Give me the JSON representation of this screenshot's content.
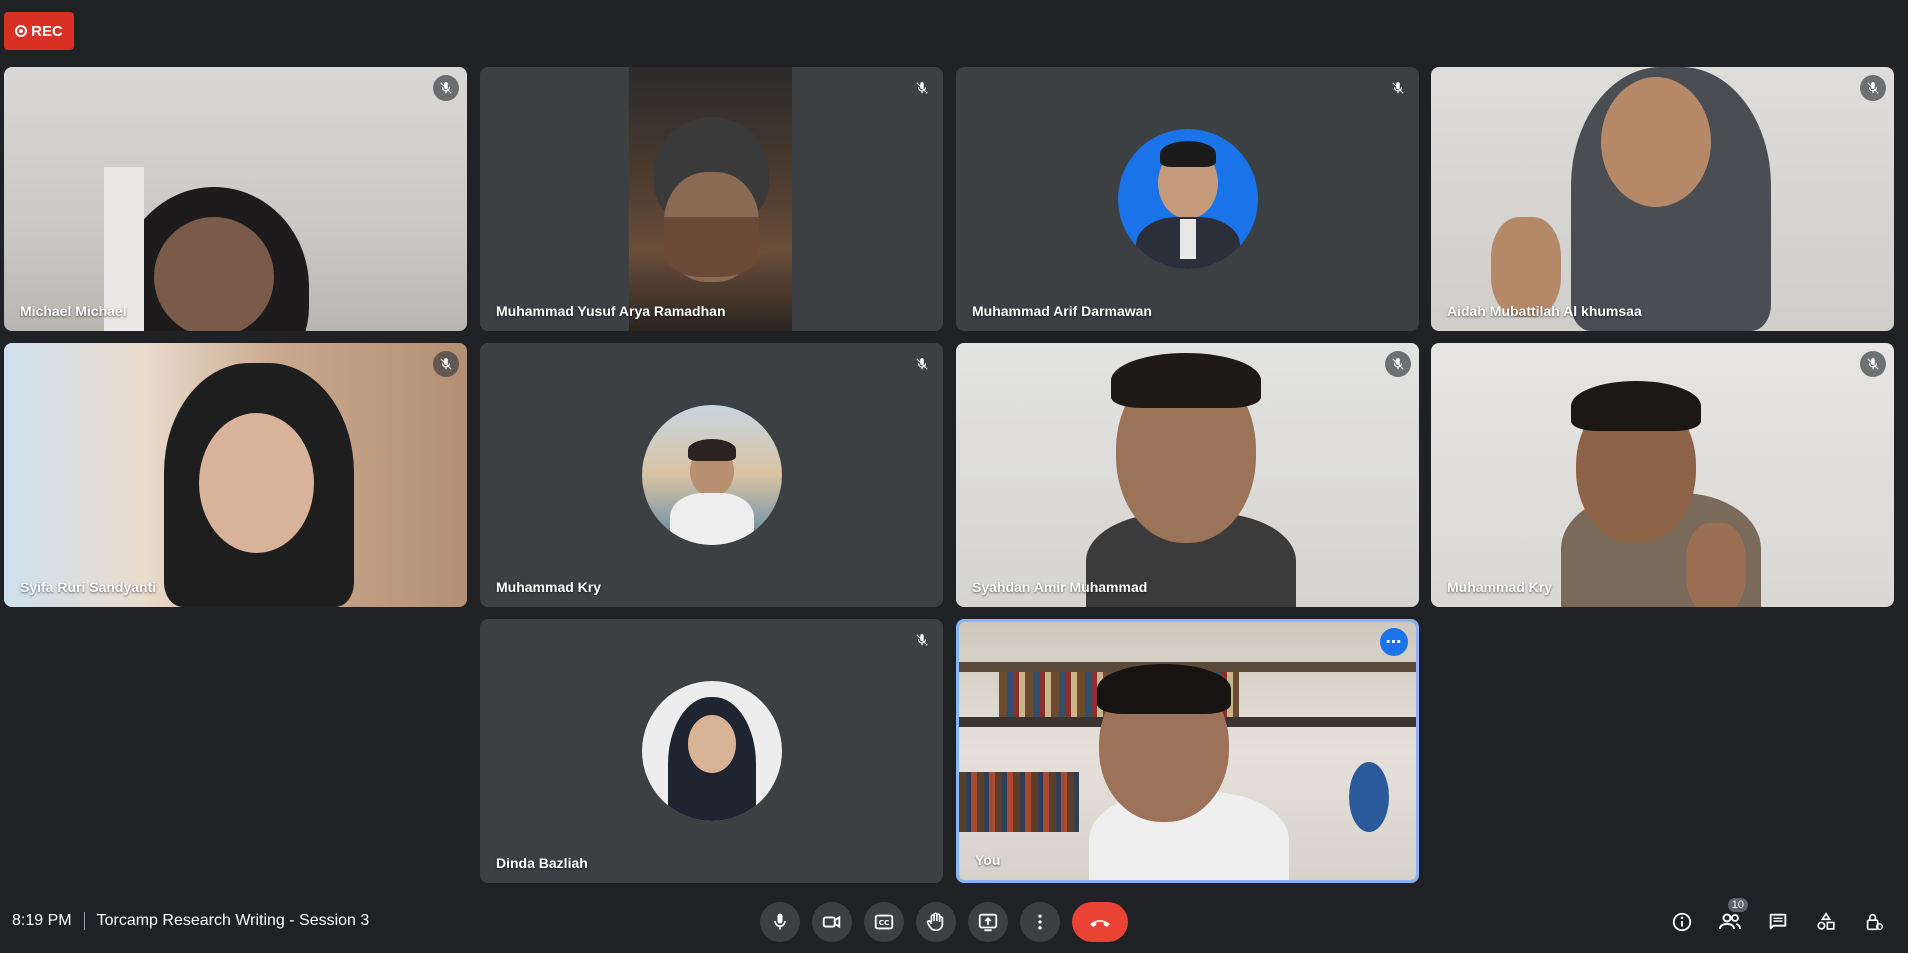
{
  "recording": {
    "label": "REC"
  },
  "participants": [
    {
      "name": "Michael Michael",
      "muted": true
    },
    {
      "name": "Muhammad Yusuf Arya Ramadhan",
      "muted": true
    },
    {
      "name": "Muhammad Arif Darmawan",
      "muted": true
    },
    {
      "name": "Aidah Mubattilah Al khumsaa",
      "muted": true
    },
    {
      "name": "Syifa Ruri Sandyanti",
      "muted": true
    },
    {
      "name": "Muhammad Kry",
      "muted": true
    },
    {
      "name": "Syahdan Amir Muhammad",
      "muted": true
    },
    {
      "name": "Muhammad Kry",
      "muted": true
    },
    {
      "name": "Dinda Bazliah",
      "muted": true
    },
    {
      "name": "You",
      "muted": false
    }
  ],
  "bottom_bar": {
    "time": "8:19 PM",
    "meeting_title": "Torcamp Research Writing - Session 3",
    "participant_count": "10"
  },
  "colors": {
    "background": "#202124",
    "tile": "#3c4043",
    "rec": "#d93025",
    "end_call": "#ea4335",
    "accent": "#1a73e8",
    "selected_border": "#8ab4f8"
  },
  "icons": {
    "mic": "mic-icon",
    "camera": "camera-icon",
    "captions": "captions-icon",
    "hand": "raise-hand-icon",
    "present": "present-icon",
    "more": "more-vert-icon",
    "end": "end-call-icon",
    "info": "info-icon",
    "people": "people-icon",
    "chat": "chat-icon",
    "activities": "activities-icon",
    "host": "host-controls-icon"
  }
}
